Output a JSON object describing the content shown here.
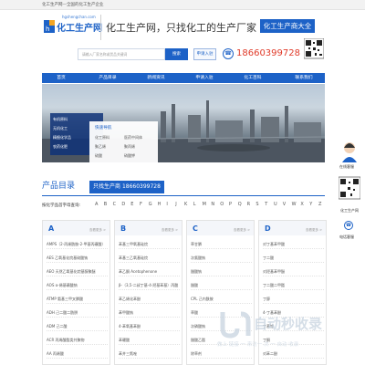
{
  "topbar": {
    "text": "化工生产网—全国的化工生产企业"
  },
  "logo": {
    "url": "hgshengchan.com",
    "name": "化工生产网"
  },
  "header": {
    "slogan": "化工生产网，只找化工的生产厂家",
    "big_button": "化工生产商大全",
    "search_placeholder": "请输入厂家名称或货品关键词",
    "search_button": "搜索",
    "join_button": "申请入驻",
    "phone": "18660399728"
  },
  "nav": {
    "items": [
      "首页",
      "产品目录",
      "新闻资讯",
      "申请入驻",
      "化工百科",
      "联系我们"
    ]
  },
  "banner": {
    "panel_title": "快速导航",
    "panel_items": [
      [
        "化工原料",
        "医药中间体"
      ],
      [
        "聚乙烯",
        "聚丙烯"
      ],
      [
        "硫酸",
        "硝酸钾"
      ]
    ],
    "side_items": [
      "有机原料",
      "无机化工",
      "精细化学品",
      "农药化肥"
    ]
  },
  "section": {
    "title": "产品目录",
    "subtitle": "只找生产商",
    "phone": "18660399728"
  },
  "alphabet": {
    "label": "按化学品首字母查询:",
    "letters": [
      "A",
      "B",
      "C",
      "D",
      "E",
      "F",
      "G",
      "H",
      "I",
      "J",
      "K",
      "L",
      "M",
      "N",
      "O",
      "P",
      "Q",
      "R",
      "S",
      "T",
      "U",
      "V",
      "W",
      "X",
      "Y",
      "Z"
    ]
  },
  "columns": [
    {
      "letter": "A",
      "more": "查看更多 >",
      "items": [
        "AMPS（2-丙烯酰胺-2-甲基丙磺酸）",
        "AES 乙氧基化烷基硫酸钠",
        "AEO 天然乙氧基化烷基醇聚醚",
        "AOS α-烯基磺酸钠",
        "ATMP 氨基三甲叉膦酸",
        "ADH 己二酸二酰肼",
        "ADM 己二酸",
        "ACR 丙烯酸酯类共聚物",
        "AA 丙烯酸"
      ]
    },
    {
      "letter": "B",
      "more": "查看更多 >",
      "items": [
        "苯基三甲氧基硅烷",
        "苯基三乙氧基硅烷",
        "苯乙酮 Acetophenone",
        "β-（3,5-二叔丁基-4-羟基苯基）丙酸",
        "苯乙烯化苯酚",
        "苯甲酸钠",
        "4-苯氧基苯酚",
        "苯硼酸",
        "苯并三氮唑"
      ]
    },
    {
      "letter": "C",
      "more": "查看更多 >",
      "items": [
        "草甘膦",
        "次氯酸钠",
        "醋酸钠",
        "醋酸",
        "CPL 己内酰胺",
        "草酸",
        "次磷酸钠",
        "醋酸乙酯",
        "除草剂"
      ]
    },
    {
      "letter": "D",
      "more": "查看更多 >",
      "items": [
        "对丁基苯甲酸",
        "丁二酸",
        "对羟基苯甲醚",
        "丁二酸二甲酯",
        "丁醇",
        "4-丁基苯酚",
        "丁基锂",
        "丁酮",
        "对苯二酚"
      ]
    }
  ],
  "float": {
    "label1": "在线客服",
    "label2": "化工生产网",
    "label3": "电话客服"
  },
  "watermark": {
    "main": "自动秒收录",
    "sub": "做上 链接 一 来访一 次 一 自动 收录"
  }
}
